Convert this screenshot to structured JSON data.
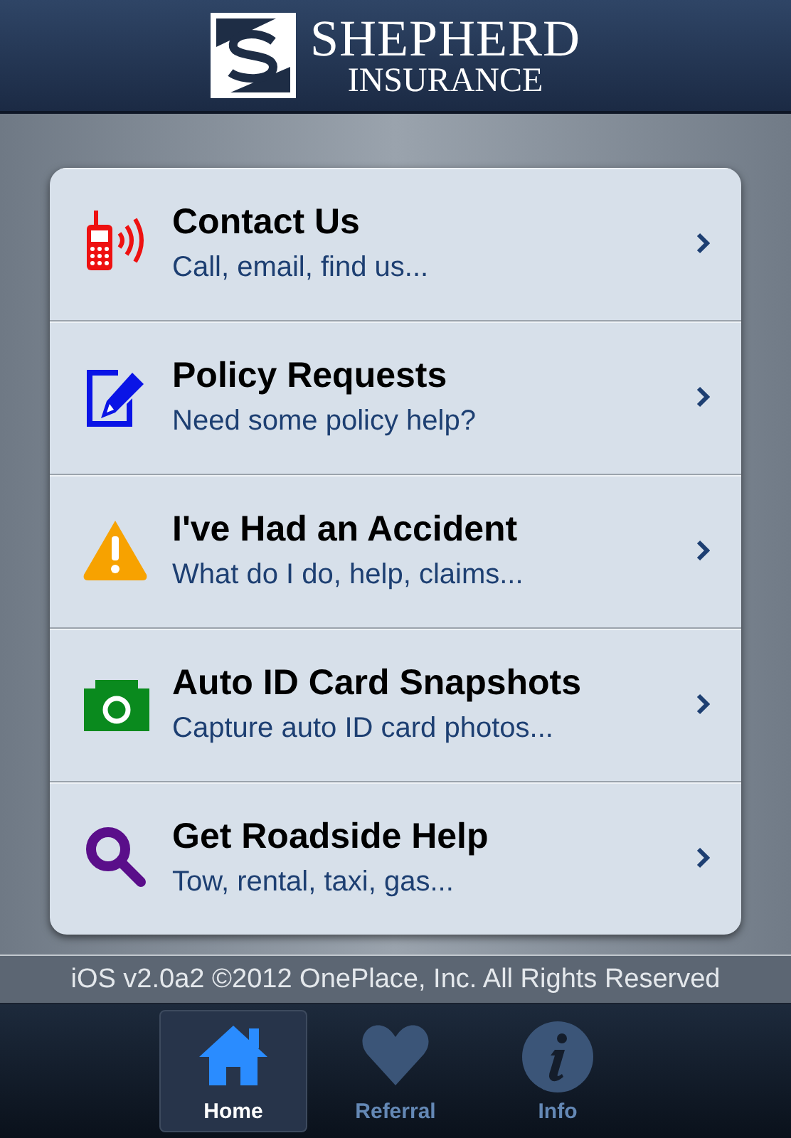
{
  "header": {
    "brand": "SHEPHERD",
    "tagline": "INSURANCE"
  },
  "menu": [
    {
      "kind": "phone",
      "title": "Contact Us",
      "subtitle": "Call, email, find us..."
    },
    {
      "kind": "edit",
      "title": "Policy Requests",
      "subtitle": "Need some policy help?"
    },
    {
      "kind": "warning",
      "title": "I've Had an Accident",
      "subtitle": "What do I do, help, claims..."
    },
    {
      "kind": "camera",
      "title": "Auto ID Card Snapshots",
      "subtitle": "Capture auto ID card photos..."
    },
    {
      "kind": "search",
      "title": "Get Roadside Help",
      "subtitle": "Tow, rental, taxi, gas..."
    }
  ],
  "footer": "iOS v2.0a2 ©2012 OnePlace, Inc. All Rights Reserved",
  "tabs": [
    {
      "kind": "home",
      "label": "Home",
      "selected": true
    },
    {
      "kind": "heart",
      "label": "Referral",
      "selected": false
    },
    {
      "kind": "info",
      "label": "Info",
      "selected": false
    }
  ]
}
